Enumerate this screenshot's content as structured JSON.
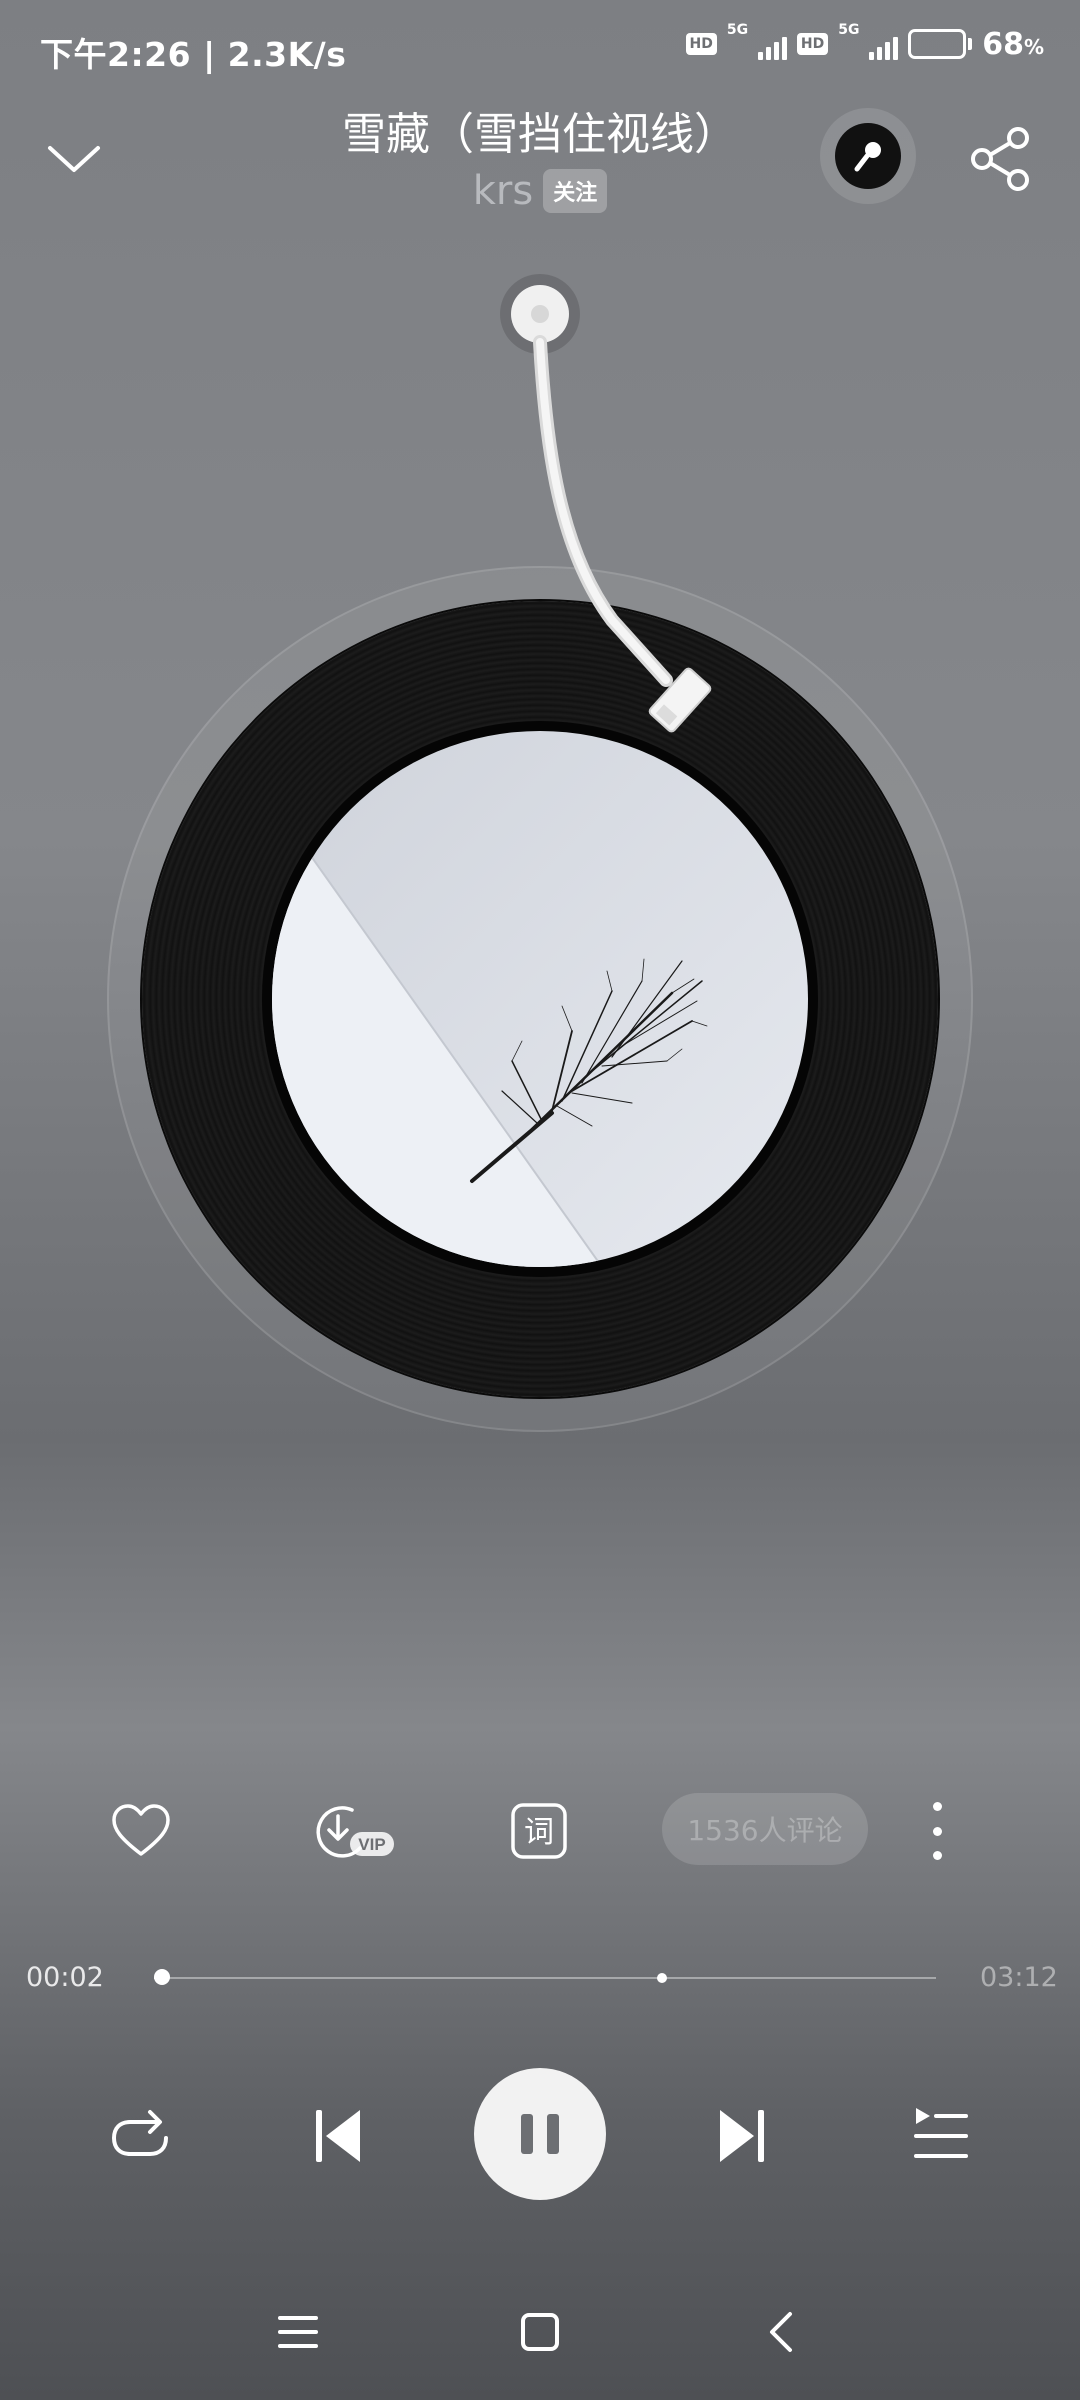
{
  "status_bar": {
    "time_speed": "下午2:26 | 2.3K/s",
    "hd1": "HD",
    "gen1": "5G",
    "hd2": "HD",
    "gen2": "5G",
    "battery_percent": "68",
    "battery_unit": "%",
    "battery_level": 0.68
  },
  "header": {
    "title": "雪藏（雪挡住视线）",
    "artist": "krs",
    "follow_label": "关注",
    "collapse_icon": "chevron-down-icon",
    "karaoke_icon": "microphone-icon",
    "share_icon": "share-icon"
  },
  "actions": {
    "like_icon": "heart-icon",
    "download_icon": "download-icon",
    "download_badge": "VIP",
    "lyrics_label": "词",
    "comments_label": "1536人评论",
    "more_icon": "more-vertical-icon"
  },
  "progress": {
    "current": "00:02",
    "total": "03:12",
    "played_fraction": 0.01,
    "buffered_fraction": 0.65
  },
  "controls": {
    "repeat_icon": "repeat-icon",
    "previous_icon": "skip-previous-icon",
    "pause_icon": "pause-icon",
    "next_icon": "skip-next-icon",
    "playlist_icon": "playlist-icon"
  },
  "nav_bar": {
    "menu_icon": "menu-icon",
    "home_icon": "home-icon",
    "back_icon": "back-icon"
  }
}
